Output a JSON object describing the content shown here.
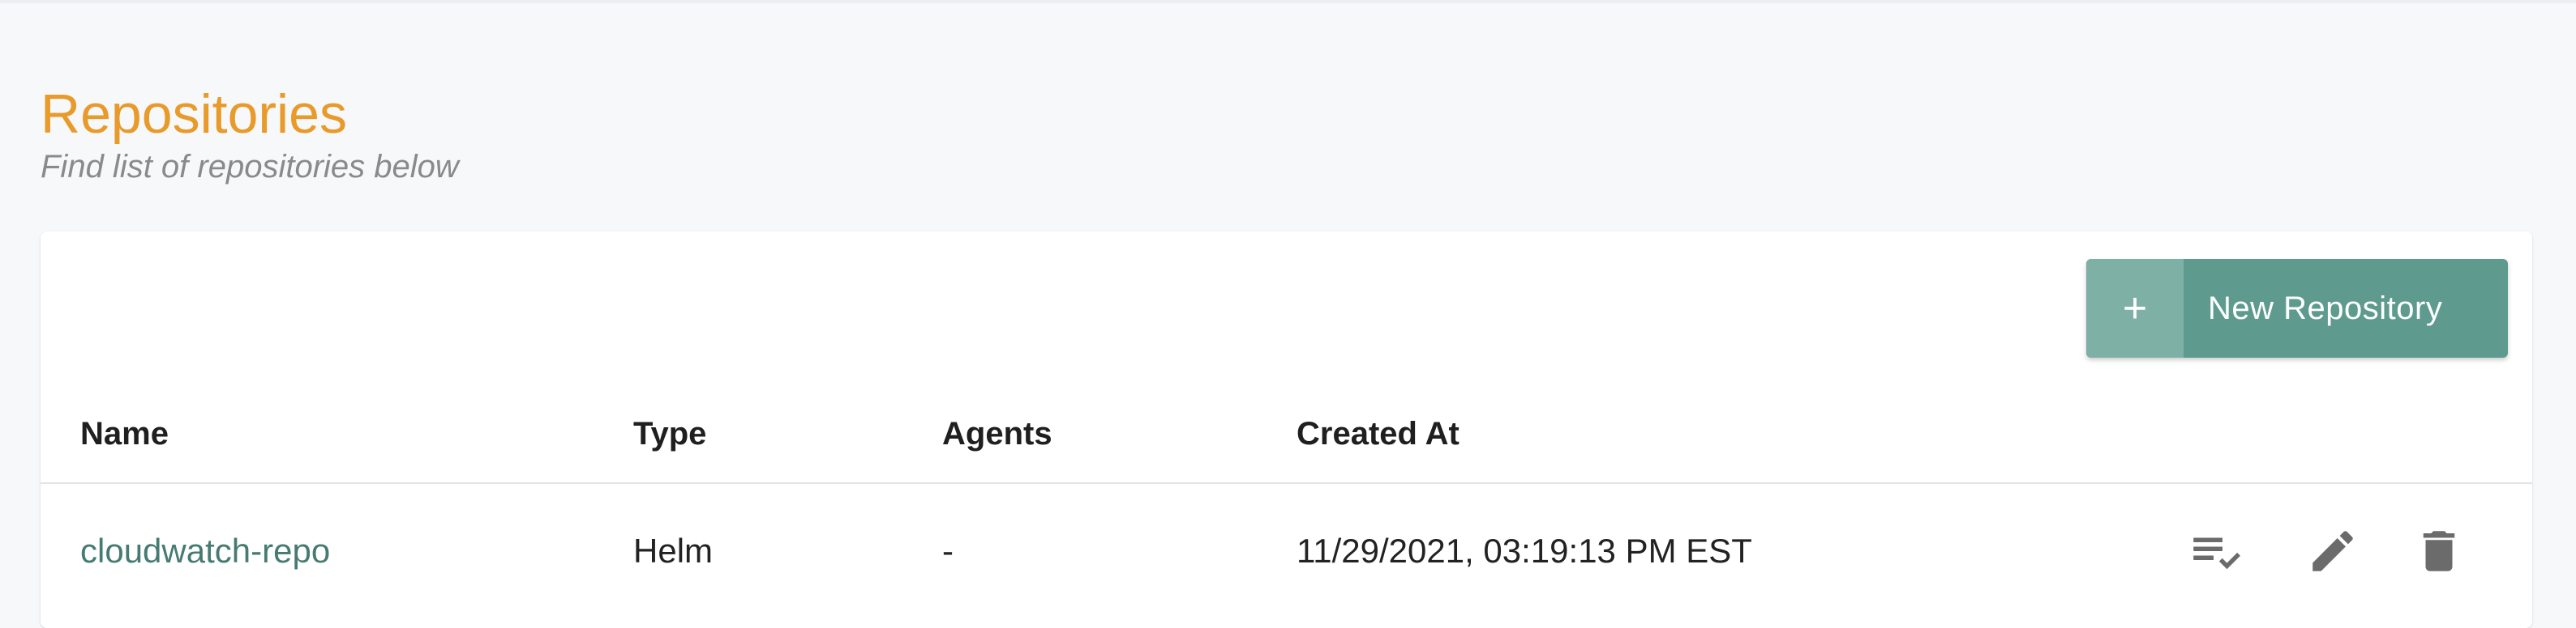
{
  "header": {
    "title": "Repositories",
    "subtitle": "Find list of repositories below"
  },
  "toolbar": {
    "new_button_icon": "plus-icon",
    "new_button_label": "New Repository",
    "plus_glyph": "+"
  },
  "table": {
    "columns": [
      "Name",
      "Type",
      "Agents",
      "Created At"
    ],
    "rows": [
      {
        "name": "cloudwatch-repo",
        "type": "Helm",
        "agents": "-",
        "created_at": "11/29/2021, 03:19:13 PM EST",
        "actions": [
          "playlist-check-icon",
          "pencil-icon",
          "trash-icon"
        ]
      }
    ]
  },
  "colors": {
    "title": "#e89a2a",
    "accent": "#5e9b8e",
    "accent_light": "#7fb0a6",
    "link": "#467b72",
    "icon": "#6b6b6b",
    "background": "#f7f8fa"
  }
}
